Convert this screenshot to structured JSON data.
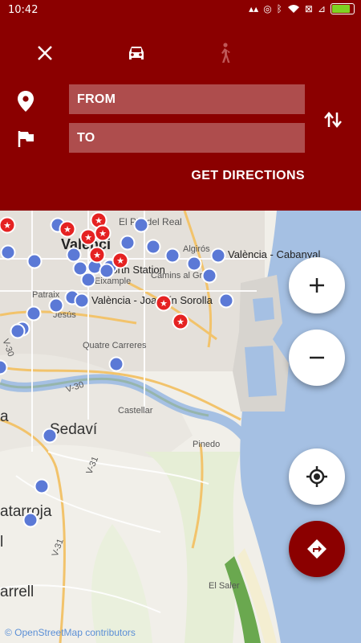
{
  "status": {
    "time": "10:42"
  },
  "header": {
    "from_placeholder": "FROM",
    "to_placeholder": "TO",
    "get_directions_label": "GET DIRECTIONS"
  },
  "map": {
    "labels": {
      "city": "Valènci",
      "pla_real": "El Pla del Real",
      "algiros": "Algirós",
      "cabanyal": "València - Cabanyal",
      "north_station": "North Station",
      "eixample": "Eixample",
      "camins": "Camins al Grau",
      "joaquin": "València - Joaquín Sorolla",
      "patraix": "Patraix",
      "jesus": "Jesús",
      "quatre": "Quatre Carreres",
      "v30a": "V-30",
      "v30b": "V-30",
      "castellar": "Castellar",
      "sedavi": "Sedaví",
      "pinedo": "Pinedo",
      "v31a": "V-31",
      "v31b": "V-31",
      "catarroja": "atarroja",
      "lchar": "l",
      "elsaler": "El Saler",
      "albal": "a",
      "arrell": "arrell"
    },
    "attribution": "© OpenStreetMap contributors"
  },
  "colors": {
    "header": "#8b0000",
    "water": "#a5c0e3",
    "land": "#f1efe9",
    "park": "#e6eed6"
  }
}
